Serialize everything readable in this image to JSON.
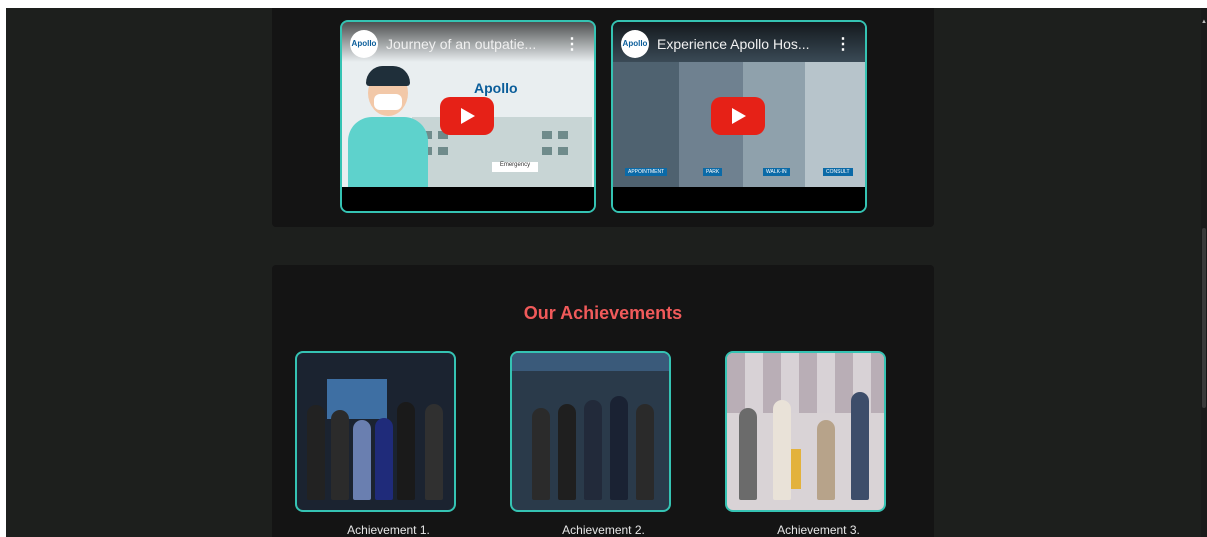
{
  "videos": [
    {
      "title": "Journey of an outpatie...",
      "channel": "Apollo",
      "logo_text": "Apollo",
      "sign_text": "Emergency",
      "more_icon": "more-vert-icon",
      "play_icon": "play-icon"
    },
    {
      "title": "Experience Apollo Hos...",
      "channel": "Apollo",
      "more_icon": "more-vert-icon",
      "play_icon": "play-icon",
      "tags": [
        "APPOINTMENT",
        "PARK",
        "WALK-IN",
        "CONSULT"
      ]
    }
  ],
  "achievements": {
    "title": "Our Achievements",
    "items": [
      {
        "caption": "Achievement 1."
      },
      {
        "caption": "Achievement 2."
      },
      {
        "caption": "Achievement 3."
      }
    ]
  },
  "colors": {
    "accent": "#35c3b3",
    "heading": "#f05a5a",
    "background": "#1d1f1d",
    "section": "#141414",
    "youtube_red": "#e62117"
  }
}
